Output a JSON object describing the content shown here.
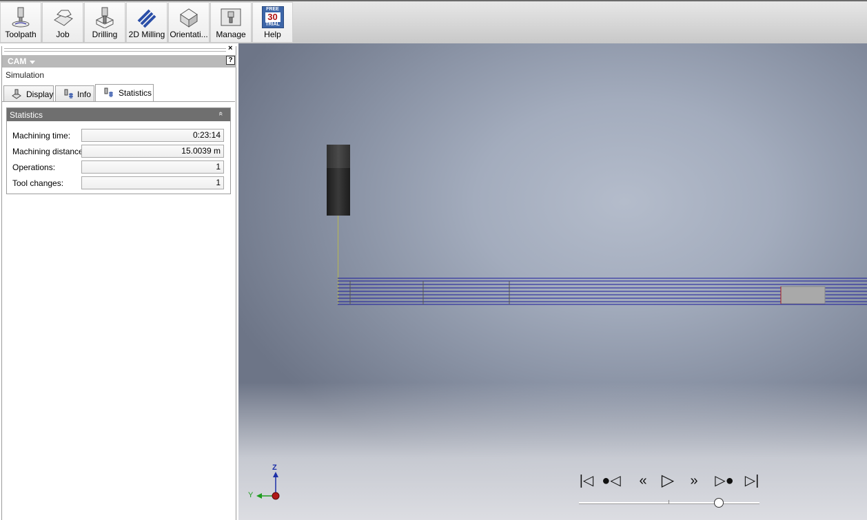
{
  "ribbon": {
    "buttons": [
      {
        "label": "Toolpath",
        "icon": "toolpath-icon"
      },
      {
        "label": "Job",
        "icon": "job-icon"
      },
      {
        "label": "Drilling",
        "icon": "drilling-icon"
      },
      {
        "label": "2D Milling",
        "icon": "2d-milling-icon"
      },
      {
        "label": "Orientati...",
        "icon": "orientation-icon"
      },
      {
        "label": "Manage",
        "icon": "manage-icon"
      },
      {
        "label": "Help",
        "icon": "free-trial-icon"
      }
    ],
    "trial_badge": {
      "top": "FREE",
      "days": "30",
      "bottom": "TRIAL"
    }
  },
  "panel": {
    "close": "×",
    "title": "CAM",
    "help": "?",
    "subtitle": "Simulation",
    "tabs": [
      {
        "label": "Display",
        "active": false
      },
      {
        "label": "Info",
        "active": false
      },
      {
        "label": "Statistics",
        "active": true
      }
    ],
    "statistics": {
      "title": "Statistics",
      "collapse": "«",
      "rows": [
        {
          "label": "Machining time:",
          "value": "0:23:14"
        },
        {
          "label": "Machining distance:",
          "value": "15.0039 m"
        },
        {
          "label": "Operations:",
          "value": "1"
        },
        {
          "label": "Tool changes:",
          "value": "1"
        }
      ]
    }
  },
  "viewport": {
    "axis": {
      "z": "Z",
      "y": "Y"
    },
    "player": {
      "first": "|◁",
      "prev_op": "●◁",
      "rewind": "«",
      "play": "▷",
      "forward": "»",
      "next_op": "▷●",
      "last": "▷|",
      "position": 0.77
    }
  },
  "colors": {
    "path": "#1a1a9a",
    "tool": "#2a2a2a",
    "axis_z": "#1c2fa8",
    "axis_y": "#1e9c1e",
    "axis_origin": "#b01818"
  }
}
